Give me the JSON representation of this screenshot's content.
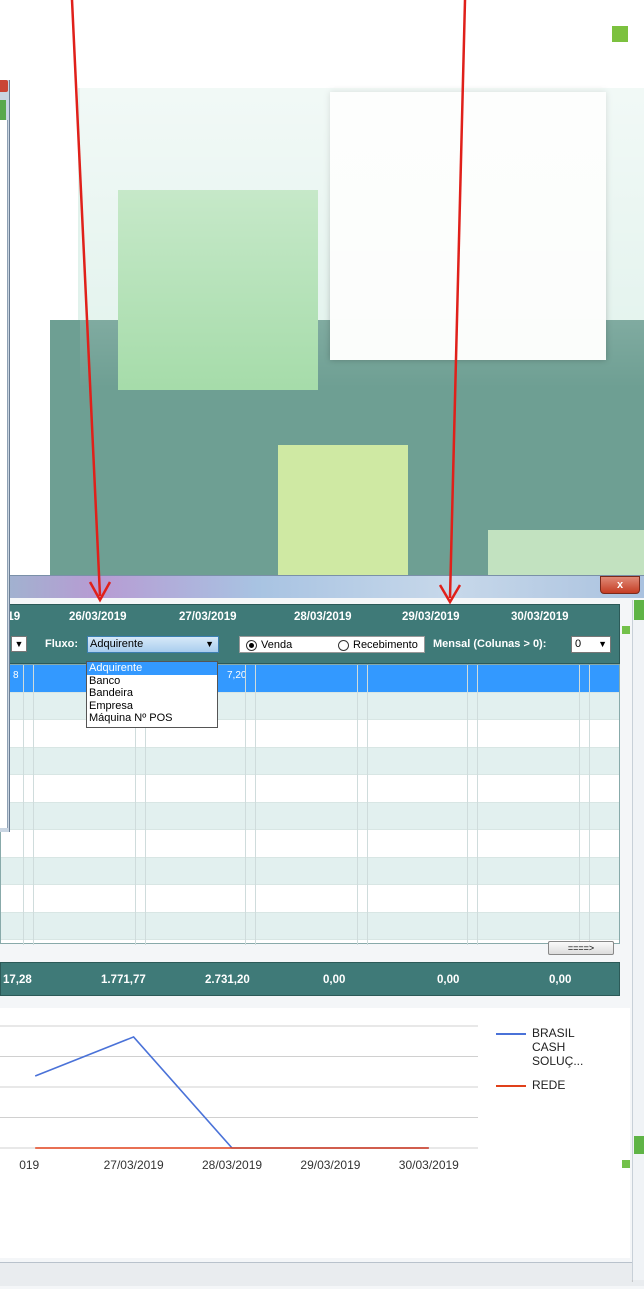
{
  "window": {
    "close_label": "x"
  },
  "header": {
    "dates": [
      "019",
      "26/03/2019",
      "27/03/2019",
      "28/03/2019",
      "29/03/2019",
      "30/03/2019"
    ],
    "fluxo_label": "Fluxo:",
    "fluxo_value": "Adquirente",
    "radio_venda": "Venda",
    "radio_recebimento": "Recebimento",
    "radio_selected": "Venda",
    "mensal_label": "Mensal (Colunas > 0):",
    "mensal_value": "0"
  },
  "dropdown": {
    "options": [
      "Adquirente",
      "Banco",
      "Bandeira",
      "Empresa",
      "Máquina Nº POS"
    ],
    "selected_index": 0
  },
  "grid": {
    "selected_row_fragments": [
      "8",
      "7,20"
    ],
    "scroll_button": "====>"
  },
  "totals": [
    "17,28",
    "1.771,77",
    "2.731,20",
    "0,00",
    "0,00",
    "0,00"
  ],
  "chart_data": {
    "type": "line",
    "categories": [
      "019",
      "27/03/2019",
      "28/03/2019",
      "29/03/2019",
      "30/03/2019"
    ],
    "series": [
      {
        "name": "BRASIL CASH SOLUÇ...",
        "color": "#4a72d8",
        "values": [
          1771.77,
          2731.2,
          0,
          0,
          0
        ]
      },
      {
        "name": "REDE",
        "color": "#e0401a",
        "values": [
          0,
          0,
          0,
          0,
          0
        ]
      }
    ],
    "ylim": [
      0,
      3000
    ],
    "grid": true,
    "legend_position": "right"
  },
  "colors": {
    "header_teal": "#3f7a78",
    "selection_blue": "#3399ff",
    "arrow_red": "#e0201a"
  }
}
